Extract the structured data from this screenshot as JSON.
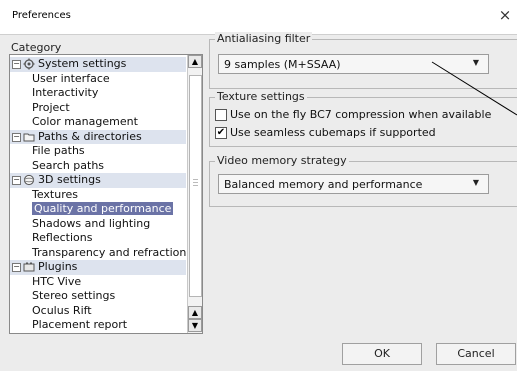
{
  "window": {
    "title": "Preferences",
    "close_glyph": "×"
  },
  "category": {
    "label": "Category",
    "rows": [
      {
        "kind": "group",
        "label": "System settings",
        "icon": "gear-icon"
      },
      {
        "kind": "child",
        "label": "User interface"
      },
      {
        "kind": "child",
        "label": "Interactivity"
      },
      {
        "kind": "child",
        "label": "Project"
      },
      {
        "kind": "child",
        "label": "Color management"
      },
      {
        "kind": "group",
        "label": "Paths & directories",
        "icon": "folder-icon"
      },
      {
        "kind": "child",
        "label": "File paths"
      },
      {
        "kind": "child",
        "label": "Search paths"
      },
      {
        "kind": "group",
        "label": "3D settings",
        "icon": "sphere-icon"
      },
      {
        "kind": "child",
        "label": "Textures"
      },
      {
        "kind": "child",
        "label": "Quality and performance",
        "selected": true
      },
      {
        "kind": "child",
        "label": "Shadows and lighting"
      },
      {
        "kind": "child",
        "label": "Reflections"
      },
      {
        "kind": "child",
        "label": "Transparency and refraction"
      },
      {
        "kind": "group",
        "label": "Plugins",
        "icon": "plugin-icon"
      },
      {
        "kind": "child",
        "label": "HTC Vive"
      },
      {
        "kind": "child",
        "label": "Stereo settings"
      },
      {
        "kind": "child",
        "label": "Oculus Rift"
      },
      {
        "kind": "child",
        "label": "Placement report"
      }
    ],
    "collapse_glyph": "−"
  },
  "antialiasing": {
    "title": "Antialiasing filter",
    "value": "9 samples (M+SSAA)"
  },
  "texture": {
    "title": "Texture settings",
    "bc7": {
      "label": "Use on the fly BC7 compression when available",
      "checked": false
    },
    "seamless": {
      "label": "Use seamless cubemaps if supported",
      "checked": true
    }
  },
  "video": {
    "title": "Video memory strategy",
    "value": "Balanced memory and performance"
  },
  "buttons": {
    "ok": "OK",
    "cancel": "Cancel"
  },
  "colors": {
    "selection": "#6b73a6",
    "group_row": "#dde3ee",
    "panel_bg": "#ececec"
  }
}
